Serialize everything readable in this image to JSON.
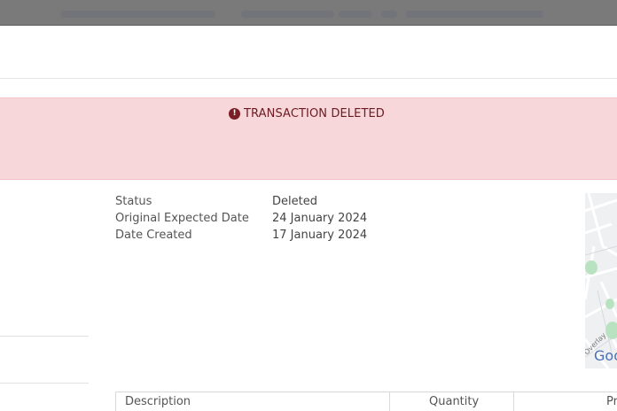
{
  "alert": {
    "icon": "exclamation-circle-icon",
    "text": "TRANSACTION DELETED",
    "bg_color": "#f8d7da",
    "text_color": "#6b1b22"
  },
  "details": [
    {
      "label": "Status",
      "value": "Deleted"
    },
    {
      "label": "Original Expected Date",
      "value": "24 January 2024"
    },
    {
      "label": "Date Created",
      "value": "17 January 2024"
    }
  ],
  "map": {
    "attribution": "Google",
    "overlay_text": "Overlay"
  },
  "table": {
    "columns": [
      "Description",
      "Quantity",
      "Pr"
    ]
  }
}
